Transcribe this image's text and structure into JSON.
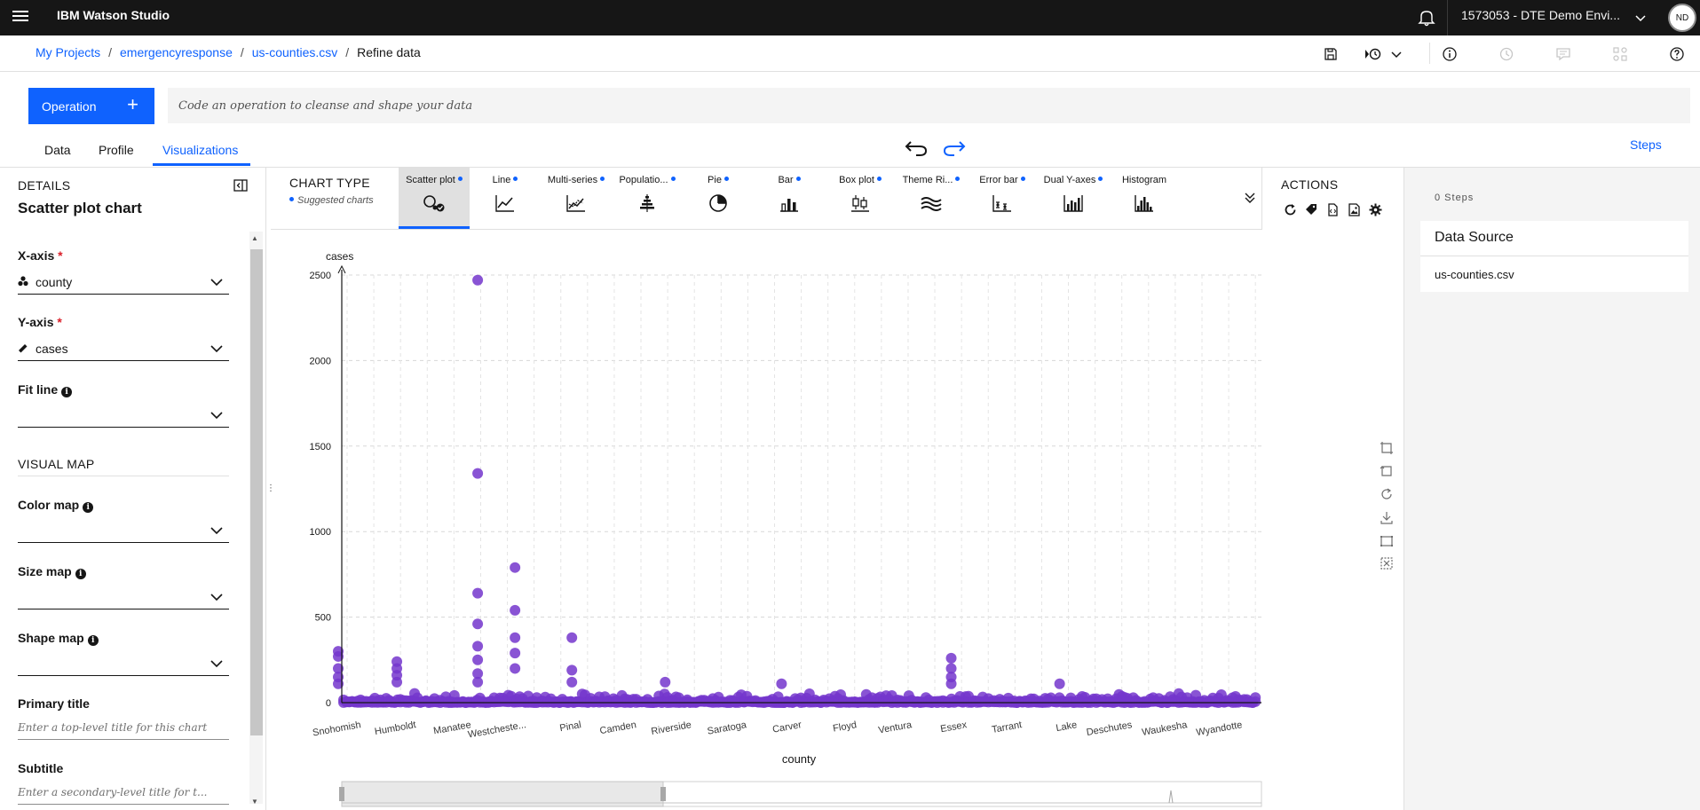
{
  "topbar": {
    "brand": "IBM Watson Studio",
    "account": "1573053 - DTE Demo Envi...",
    "avatar_initials": "ND"
  },
  "breadcrumb": {
    "items": [
      "My Projects",
      "emergencyresponse",
      "us-counties.csv"
    ],
    "current": "Refine data",
    "separator": "/"
  },
  "operation": {
    "button_label": "Operation",
    "button_icon": "+",
    "placeholder": "Code an operation to cleanse and shape your data"
  },
  "tabs": [
    "Data",
    "Profile",
    "Visualizations"
  ],
  "active_tab": "Visualizations",
  "steps_link": "Steps",
  "details": {
    "header": "DETAILS",
    "title": "Scatter plot chart",
    "x_axis_label": "X-axis",
    "x_axis_value": "county",
    "y_axis_label": "Y-axis",
    "y_axis_value": "cases",
    "required_mark": "*",
    "fit_line_label": "Fit line",
    "visual_map_header": "VISUAL MAP",
    "color_map_label": "Color map",
    "size_map_label": "Size map",
    "shape_map_label": "Shape map",
    "primary_title_label": "Primary title",
    "primary_title_placeholder": "Enter a top-level title for this chart",
    "subtitle_label": "Subtitle",
    "subtitle_placeholder": "Enter a secondary-level title for t..."
  },
  "chart_type": {
    "header": "CHART TYPE",
    "suggested": "Suggested charts",
    "items": [
      {
        "label": "Scatter plot",
        "icon": "scatter-icon"
      },
      {
        "label": "Line",
        "icon": "line-chart-icon"
      },
      {
        "label": "Multi-series",
        "icon": "multi-series-icon"
      },
      {
        "label": "Populatio...",
        "icon": "population-pyramid-icon"
      },
      {
        "label": "Pie",
        "icon": "pie-icon"
      },
      {
        "label": "Bar",
        "icon": "bar-icon"
      },
      {
        "label": "Box plot",
        "icon": "box-plot-icon"
      },
      {
        "label": "Theme Ri...",
        "icon": "theme-river-icon"
      },
      {
        "label": "Error bar",
        "icon": "error-bar-icon"
      },
      {
        "label": "Dual Y-axes",
        "icon": "dual-y-axes-icon"
      },
      {
        "label": "Histogram",
        "icon": "histogram-icon"
      }
    ]
  },
  "actions": {
    "header": "ACTIONS"
  },
  "steps_panel": {
    "count": "0 Steps",
    "data_source_title": "Data Source",
    "data_source_file": "us-counties.csv"
  },
  "colors": {
    "accent": "#0f62fe",
    "topbar": "#161616",
    "point": "#7436cc"
  },
  "chart_data": {
    "type": "scatter",
    "xlabel": "county",
    "ylabel": "cases",
    "ylim": [
      0,
      2500
    ],
    "yticks": [
      0,
      500,
      1000,
      1500,
      2000,
      2500
    ],
    "x_tick_labels": [
      "Snohomish",
      "Humboldt",
      "Manatee",
      "Westcheste...",
      "Pinal",
      "Camden",
      "Riverside",
      "Saratoga",
      "Carver",
      "Floyd",
      "Ventura",
      "Essex",
      "Tarrant",
      "Lake",
      "Deschutes",
      "Waukesha",
      "Wyandotte"
    ],
    "grid": true,
    "highlight_points": [
      {
        "x": "Manatee",
        "y": [
          2470,
          1340,
          640,
          460,
          330,
          250,
          170,
          120
        ]
      },
      {
        "x": "Westcheste...",
        "y": [
          790,
          540,
          380,
          290,
          200
        ]
      },
      {
        "x": "Snohomish",
        "y": [
          300,
          270,
          200,
          150,
          110
        ]
      },
      {
        "x": "Humboldt",
        "y": [
          240,
          200,
          160,
          120
        ]
      },
      {
        "x": "Pinal",
        "y": [
          380,
          190,
          120
        ]
      },
      {
        "x": "Essex",
        "y": [
          260,
          200,
          150,
          110
        ]
      },
      {
        "x": "Riverside",
        "y": [
          120
        ]
      },
      {
        "x": "Carver",
        "y": [
          110
        ]
      },
      {
        "x": "Lake",
        "y": [
          110
        ]
      }
    ],
    "baseline_band": [
      0,
      60
    ]
  }
}
